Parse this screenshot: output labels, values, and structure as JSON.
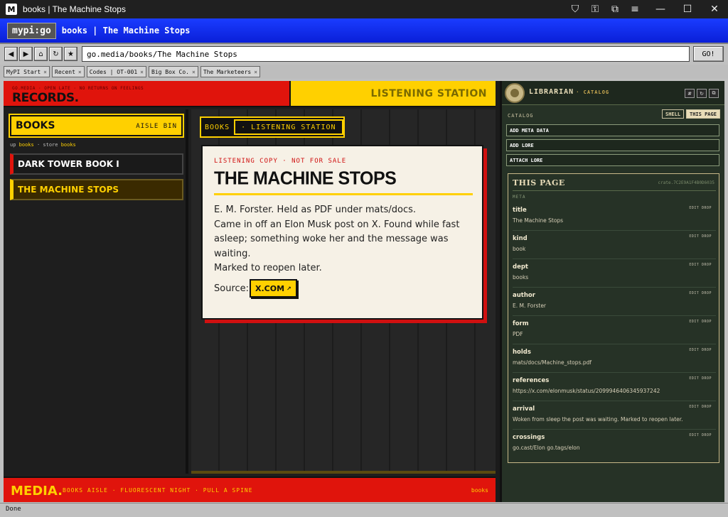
{
  "window": {
    "title": "books | The Machine Stops",
    "app_icon": "M"
  },
  "brand": {
    "logo": "mypi:go",
    "page_title": "books | The Machine Stops"
  },
  "nav": {
    "url": "go.media/books/The Machine Stops",
    "go_label": "GO!"
  },
  "tabs": [
    {
      "label": "MyPI Start"
    },
    {
      "label": "Recent"
    },
    {
      "label": "Codes | OT-001"
    },
    {
      "label": "Big Box Co."
    },
    {
      "label": "The Marketeers"
    }
  ],
  "records": {
    "tagline": "GO.MEDIA · OPEN LATE · NO RETURNS ON FEELINGS",
    "title": "RECORDS."
  },
  "listening_station": {
    "label": "LISTENING STATION"
  },
  "aisle": {
    "title": "BOOKS",
    "subtitle": "AISLE BIN",
    "crumb": {
      "up": "up",
      "books": "books",
      "sep": "·",
      "store": "store",
      "books2": "books"
    },
    "items": [
      {
        "label": "DARK TOWER BOOK I",
        "selected": false
      },
      {
        "label": "THE MACHINE STOPS",
        "selected": true
      }
    ]
  },
  "chips": {
    "books": "BOOKS",
    "station": "· LISTENING STATION"
  },
  "card": {
    "kicker": "LISTENING COPY · NOT FOR SALE",
    "title": "THE MACHINE STOPS",
    "body_lines": [
      "E. M. Forster. Held as PDF under mats/docs.",
      "Came in off an Elon Musk post on X. Found while fast",
      "asleep; something woke her and the message was waiting.",
      "Marked to reopen later."
    ],
    "source_label": "Source:",
    "source_button": "X.COM",
    "source_arrow": "↗"
  },
  "media_footer": {
    "title": "MEDIA.",
    "tagline": "BOOKS AISLE · FLUORESCENT NIGHT · PULL A SPINE",
    "right": "books"
  },
  "librarian": {
    "name": "LIBRARIAN",
    "sub": "· CATALOG",
    "icons": [
      "#",
      "↻",
      "⧉"
    ],
    "catalog_label": "CATALOG",
    "toggle_shell": "SHELL",
    "toggle_this_page": "THIS PAGE",
    "actions": [
      "ADD META DATA",
      "ADD LORE",
      "ATTACH LORE"
    ],
    "this_page": {
      "title": "THIS PAGE",
      "crate": "crate.7C2E9A1F4B0D6035",
      "meta_label": "META",
      "edit_label": "EDIT",
      "drop_label": "DROP",
      "rows": [
        {
          "key": "title",
          "value": "The Machine Stops"
        },
        {
          "key": "kind",
          "value": "book"
        },
        {
          "key": "dept",
          "value": "books"
        },
        {
          "key": "author",
          "value": "E. M. Forster"
        },
        {
          "key": "form",
          "value": "PDF"
        },
        {
          "key": "holds",
          "value": "mats/docs/Machine_stops.pdf"
        },
        {
          "key": "references",
          "value": "https://x.com/elonmusk/status/2099946406345937242"
        },
        {
          "key": "arrival",
          "value": "Woken from sleep the post was waiting. Marked to reopen later."
        },
        {
          "key": "crossings",
          "value": "go.cast/Elon  go.tags/elon"
        }
      ]
    }
  },
  "status": {
    "text": "Done"
  },
  "colors": {
    "red": "#e0140c",
    "yellow": "#ffd000",
    "blue": "#1a3cff",
    "green_panel": "#263226"
  }
}
